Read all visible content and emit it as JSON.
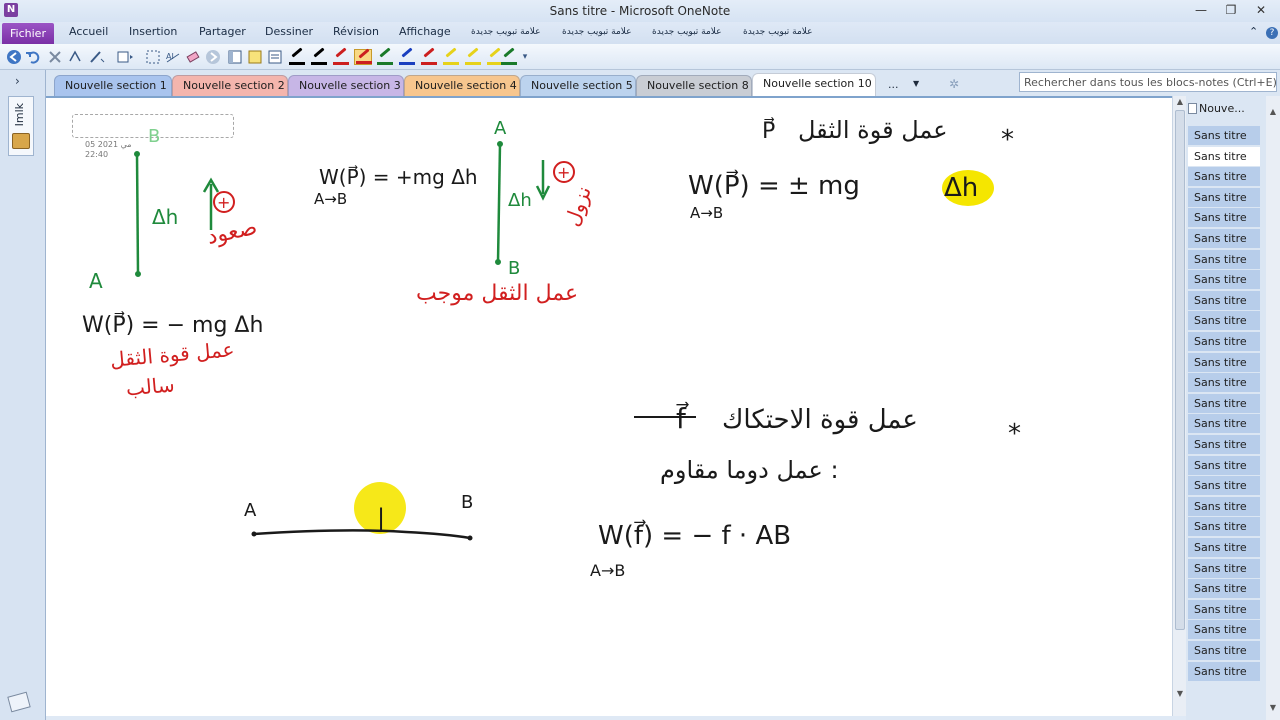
{
  "window": {
    "title": "Sans titre  -  Microsoft OneNote",
    "app_icon": "N",
    "controls": {
      "minimize": "—",
      "restore": "❐",
      "close": "✕"
    }
  },
  "ribbon": {
    "file_tab": "Fichier",
    "tabs": [
      "Accueil",
      "Insertion",
      "Partager",
      "Dessiner",
      "Révision",
      "Affichage",
      "علامة تبويب جديدة",
      "علامة تبويب جديدة",
      "علامة تبويب جديدة",
      "علامة تبويب جديدة"
    ],
    "help_icon": "?",
    "collapse_icon": "⌃"
  },
  "toolbar": {
    "pen_colors": [
      "#000000",
      "#000000",
      "#cc1f1f",
      "#cc1f1f",
      "#1a7a2a",
      "#1a3fbf",
      "#cc1f1f",
      "#e6d21a",
      "#e6d21a",
      "#e6d21a",
      "#1a7a2a"
    ],
    "selected_pen_index": 3
  },
  "sidebar": {
    "notebook_name": "Imlk",
    "expand_icon": "›"
  },
  "sections": {
    "tabs": [
      {
        "label": "Nouvelle section 1",
        "color": "#a9c4ee"
      },
      {
        "label": "Nouvelle section 2",
        "color": "#f4b5ad"
      },
      {
        "label": "Nouvelle section 3",
        "color": "#c7b6e6"
      },
      {
        "label": "Nouvelle section 4",
        "color": "#f7c68e"
      },
      {
        "label": "Nouvelle section 5",
        "color": "#bcd3ee"
      },
      {
        "label": "Nouvelle section 8",
        "color": "#c9cdd4"
      },
      {
        "label": "Nouvelle section 10",
        "color": "#ffffff"
      }
    ],
    "more": "...",
    "dropdown_icon": "▼",
    "new_section_icon": "✲",
    "search_placeholder": "Rechercher dans tous les blocs-notes (Ctrl+E)",
    "search_dropdown_icon": "▼"
  },
  "page": {
    "date": "05 مي 2021",
    "time": "22:40",
    "ink": {
      "vertical_left": {
        "label_top": "B",
        "label_bottom": "A",
        "delta": "Δh",
        "sign": "+",
        "arabic_up": "صعود"
      },
      "formula_left": {
        "text": "W(P⃗) = − mg Δh",
        "arabic_line1": "عمل قوة الثقل",
        "arabic_line2": "سالب"
      },
      "vertical_mid": {
        "label_top": "A",
        "label_bottom": "B",
        "delta": "Δh",
        "sign": "+",
        "arabic_down": "نزول",
        "arabic_note": "عمل الثقل موجب"
      },
      "formula_mid": {
        "line1": "W(P⃗) = +mg Δh",
        "line2": "A→B"
      },
      "formula_right": {
        "heading_vec": "P⃗",
        "heading": "عمل قوة الثقل",
        "star": "*",
        "line1": "W(P⃗)  =  ±  mg",
        "highlight": "Δh",
        "line2": "A→B"
      },
      "friction": {
        "vec": "f⃗",
        "heading": "عمل قوة الاحتكاك",
        "star": "*",
        "subheading": "عمل دوما مقاوم :",
        "formula": "W(f⃗) = − f · AB",
        "formula_sub": "A→B"
      },
      "segment": {
        "label_a": "A",
        "label_b": "B",
        "marker": "|"
      }
    }
  },
  "pages_panel": {
    "new_page": "Nouve...",
    "pages": [
      "Sans titre",
      "Sans titre",
      "Sans titre",
      "Sans titre",
      "Sans titre",
      "Sans titre",
      "Sans titre",
      "Sans titre",
      "Sans titre",
      "Sans titre",
      "Sans titre",
      "Sans titre",
      "Sans titre",
      "Sans titre",
      "Sans titre",
      "Sans titre",
      "Sans titre",
      "Sans titre",
      "Sans titre",
      "Sans titre",
      "Sans titre",
      "Sans titre",
      "Sans titre",
      "Sans titre",
      "Sans titre",
      "Sans titre",
      "Sans titre"
    ],
    "active_index": 1
  },
  "colors": {
    "ink_green": "#1f8a3c",
    "ink_red": "#d11f1f",
    "ink_black": "#1a1a1a",
    "highlight_yellow": "#f5e600",
    "fichier_purple": "#7a2fa6"
  }
}
